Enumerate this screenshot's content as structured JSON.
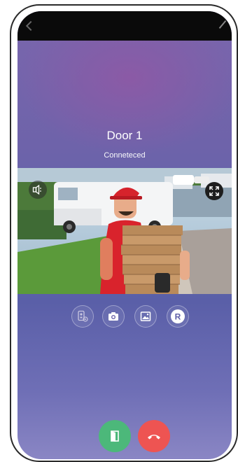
{
  "call": {
    "title": "Door 1",
    "status": "Conneteced"
  },
  "controls": {
    "speaker_icon": "speaker-icon",
    "fullscreen_icon": "fullscreen-icon",
    "actions": [
      {
        "name": "intercom-settings",
        "icon": "intercom-icon"
      },
      {
        "name": "snapshot",
        "icon": "camera-icon"
      },
      {
        "name": "gallery",
        "icon": "image-icon"
      },
      {
        "name": "record",
        "icon": "record-icon",
        "label": "R"
      }
    ],
    "unlock_color": "#4cb87a",
    "hangup_color": "#ee5452"
  }
}
